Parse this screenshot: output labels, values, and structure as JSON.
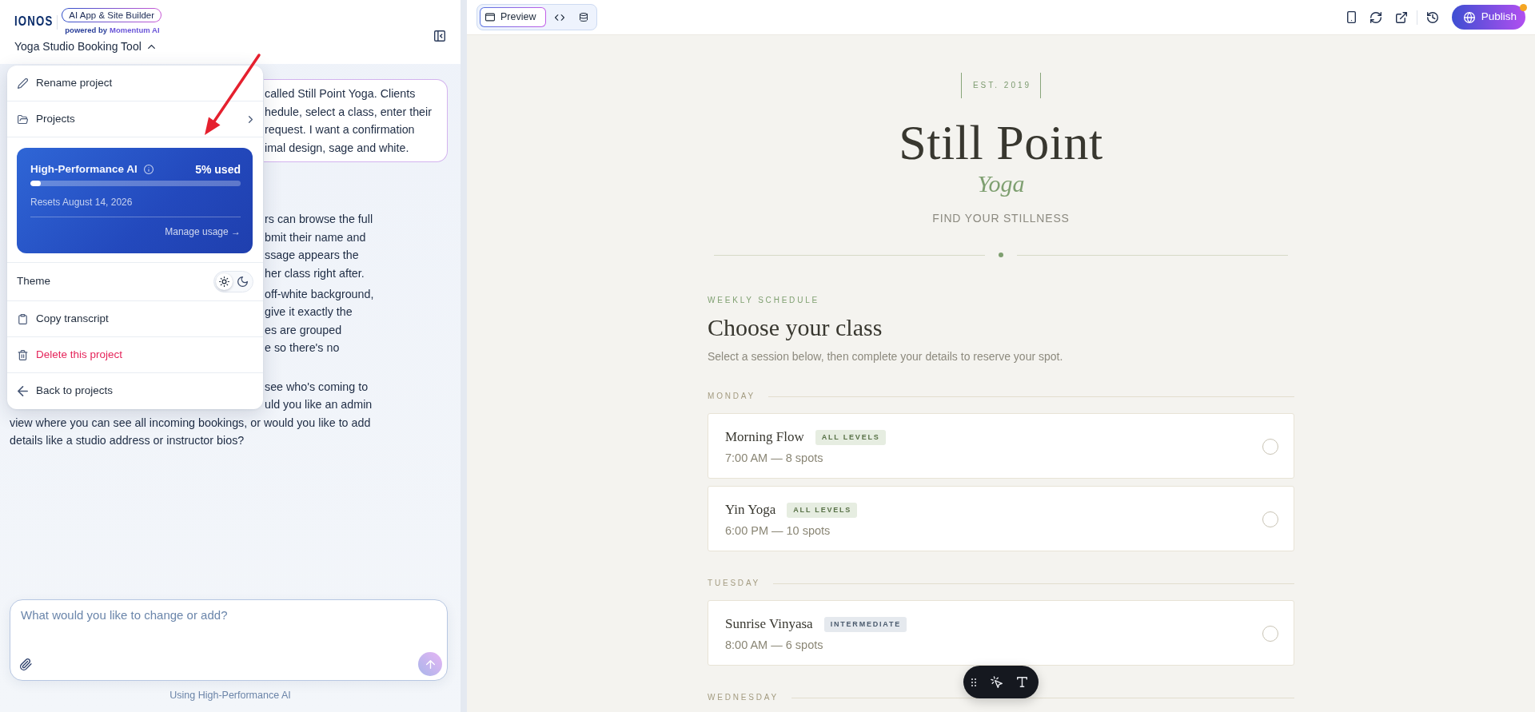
{
  "sidebar": {
    "logo": "IONOS",
    "product_badge": "AI App & Site Builder",
    "powered_by": "powered by",
    "powered_by_brand": "Momentum AI",
    "project": {
      "title": "Yoga Studio Booking Tool",
      "expanded": true
    }
  },
  "project_menu": {
    "items": [
      {
        "kind": "rename",
        "label": "Rename project"
      },
      {
        "kind": "submenu",
        "label": "Projects"
      },
      {
        "kind": "usage",
        "title": "High-Performance AI",
        "usage": "5% used",
        "level": 0.05,
        "resets": "Resets August 14, 2026",
        "link": "Manage usage →"
      },
      {
        "kind": "theme",
        "label": "Theme",
        "options": [
          {
            "kind": "light",
            "selected": true
          },
          {
            "kind": "dark",
            "selected": false
          }
        ]
      },
      {
        "kind": "copy",
        "label": "Copy transcript"
      },
      {
        "kind": "delete",
        "label": "Delete this project"
      },
      {
        "kind": "back",
        "label": "Back to projects"
      }
    ]
  },
  "chat": {
    "messages": [
      {
        "kind": "user",
        "lines": [
          {
            "text": "called Still Point Yoga. Clients",
            "clipped": true
          },
          {
            "text": "hedule, select a class, enter their",
            "clipped": true
          },
          {
            "text": "request. I want a confirmation",
            "clipped": true
          },
          {
            "text": "imal design, sage and white.",
            "clipped": true
          }
        ]
      },
      {
        "kind": "assistant",
        "paragraphs": [
          {
            "lines": [
              {
                "text": "rs can browse the full",
                "clipped": true
              },
              {
                "text": "bmit their name and",
                "clipped": true
              },
              {
                "text": "ssage appears the",
                "clipped": true
              },
              {
                "text": "her class right after.",
                "clipped": true
              }
            ]
          },
          {
            "lines": [
              {
                "text": "off-white background,",
                "clipped": true
              },
              {
                "text": "give it exactly the",
                "clipped": true
              },
              {
                "text": "es are grouped",
                "clipped": true
              },
              {
                "text": "e so there's no",
                "clipped": true
              }
            ]
          },
          {
            "lines": [
              {
                "text": "see who's coming to",
                "clipped": true
              },
              {
                "text": "uld you like an admin",
                "clipped": true
              },
              {
                "text": "view where you can see all incoming bookings, or would you like to add",
                "clipped": false
              },
              {
                "text": "details like a studio address or instructor bios?",
                "clipped": false
              }
            ]
          }
        ]
      }
    ]
  },
  "composer": {
    "placeholder": "What would you like to change or add?",
    "send": {
      "disabled": true
    },
    "footer": "Using High-Performance AI"
  },
  "toolbar": {
    "views": [
      {
        "kind": "preview",
        "label": "Preview",
        "selected": true
      },
      {
        "kind": "code",
        "selected": false
      },
      {
        "kind": "data",
        "selected": false
      }
    ],
    "publish": {
      "label": "Publish",
      "notification": true
    }
  },
  "site": {
    "established": "EST. 2019",
    "name": "Still Point",
    "subtitle": "Yoga",
    "tagline": "FIND YOUR STILLNESS",
    "section_label": "WEEKLY SCHEDULE",
    "heading": "Choose your class",
    "intro": "Select a session below, then complete your details to reserve your spot.",
    "days": [
      {
        "name": "MONDAY",
        "classes": [
          {
            "name": "Morning Flow",
            "badge": "ALL LEVELS",
            "color": "#e6ede1",
            "time": "7:00 AM — 8 spots",
            "selected": false
          },
          {
            "name": "Yin Yoga",
            "badge": "ALL LEVELS",
            "color": "#e6ede1",
            "time": "6:00 PM — 10 spots",
            "selected": false
          }
        ]
      },
      {
        "name": "TUESDAY",
        "classes": [
          {
            "name": "Sunrise Vinyasa",
            "badge": "INTERMEDIATE",
            "color": "#e5e9ee",
            "time": "8:00 AM — 6 spots",
            "selected": false
          }
        ]
      },
      {
        "name": "WEDNESDAY"
      }
    ]
  }
}
